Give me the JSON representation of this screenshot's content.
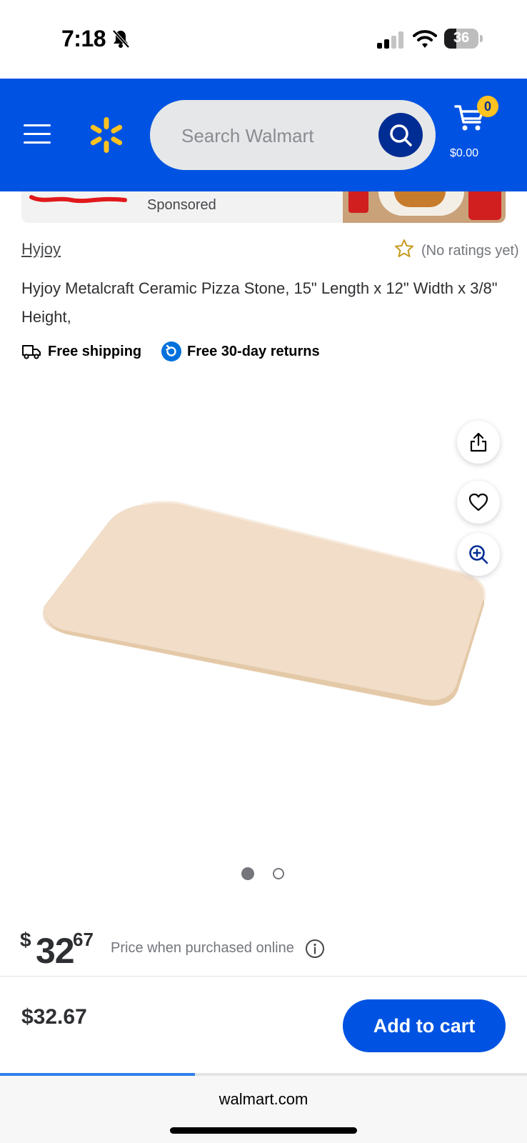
{
  "status_bar": {
    "time": "7:18",
    "battery": "36",
    "battery_level": 0.36
  },
  "header": {
    "search": {
      "placeholder": "Search Walmart"
    },
    "cart": {
      "count": "0",
      "total": "$0.00"
    },
    "icons": {
      "menu": "hamburger-menu-icon",
      "logo": "walmart-spark-icon",
      "search": "search-icon",
      "cart": "cart-icon"
    },
    "colors": {
      "brand_blue": "#0053e2",
      "search_button": "#002d93",
      "spark_yellow": "#ffc220"
    }
  },
  "banner": {
    "sponsored_label": "Sponsored"
  },
  "product": {
    "brand": "Hyjoy",
    "rating_text": "(No ratings yet)",
    "title": "Hyjoy Metalcraft Ceramic Pizza Stone, 15\" Length x 12\" Width x 3/8\" Height,",
    "badges": {
      "shipping": "Free shipping",
      "returns": "Free 30-day returns"
    },
    "image_pager": {
      "total": 2,
      "active": 1
    }
  },
  "price": {
    "symbol": "$",
    "whole": "32",
    "cents": "67",
    "note": "Price when purchased online"
  },
  "sticky_bar": {
    "price": "$32.67",
    "add_to_cart": "Add to cart"
  },
  "browser": {
    "url": "walmart.com",
    "load_progress": 0.37
  }
}
